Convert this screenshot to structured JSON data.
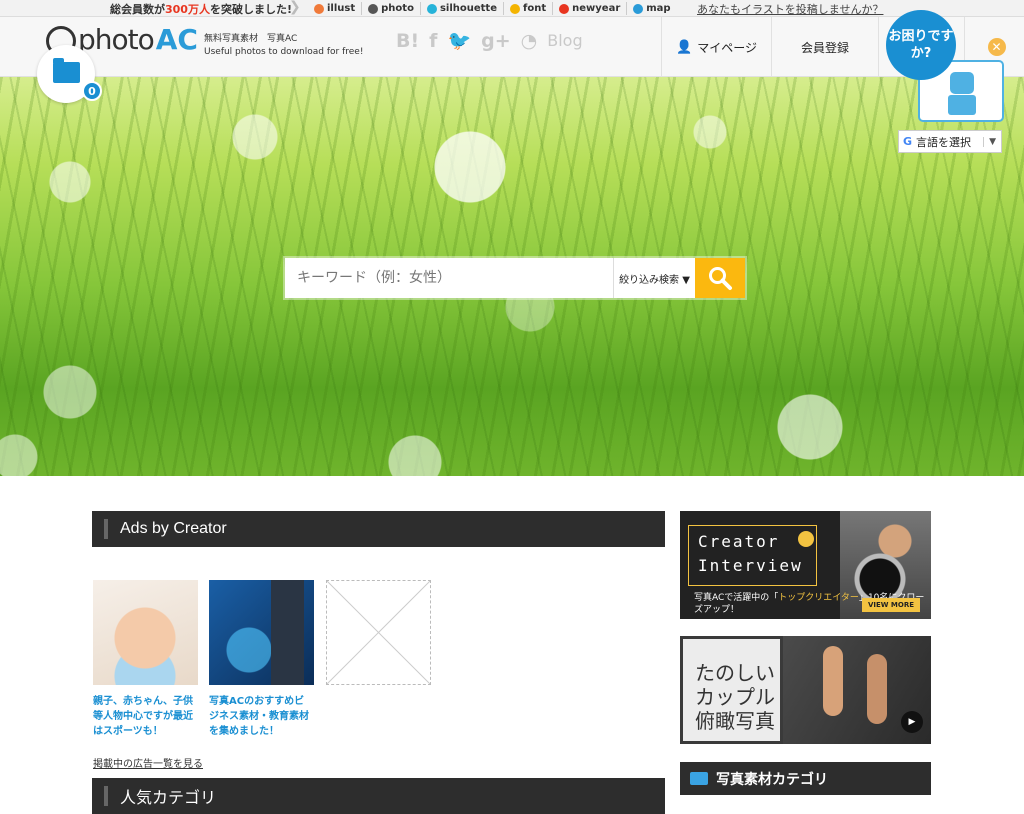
{
  "topbar": {
    "notice_prefix": "総会員数が",
    "notice_num": "300万人",
    "notice_suffix": "を突破しました!",
    "sites": [
      {
        "label": "illust",
        "icon": "illust-icon",
        "color": "#f07a3a"
      },
      {
        "label": "photo",
        "icon": "photo-icon",
        "color": "#555555"
      },
      {
        "label": "silhouette",
        "icon": "silhouette-icon",
        "color": "#26b3d9"
      },
      {
        "label": "font",
        "icon": "font-icon",
        "color": "#f4b400"
      },
      {
        "label": "newyear",
        "icon": "newyear-icon",
        "color": "#e8351f"
      },
      {
        "label": "map",
        "icon": "map-icon",
        "color": "#2a9bd8"
      }
    ],
    "post_link": "あなたもイラストを投稿しませんか？"
  },
  "header": {
    "logo_photo": "photo",
    "logo_ac": "AC",
    "tagline_1": "無料写真素材　写真AC",
    "tagline_2": "Useful photos to download for free!",
    "social": [
      "B!",
      "f",
      "🐦",
      "g+",
      "◔",
      "Blog"
    ],
    "mypage": "マイページ",
    "register": "会員登録",
    "help": "お困りですか?",
    "language": "言語を選択",
    "folder_count": "0"
  },
  "search": {
    "placeholder": "キーワード（例：女性）",
    "filter": "絞り込み検索 ▼"
  },
  "ads": {
    "title": "Ads by Creator",
    "items": [
      {
        "caption": "親子、赤ちゃん、子供等人物中心ですが最近はスポーツも！"
      },
      {
        "caption": "写真ACのおすすめビジネス素材・教育素材を集めました！"
      }
    ],
    "list_link": "掲載中の広告一覧を見る"
  },
  "popular": {
    "title": "人気カテゴリ"
  },
  "sidebar": {
    "banner1": {
      "line1": "Creator",
      "line2": "Interview",
      "sub_prefix": "写真ACで活躍中の「",
      "sub_highlight": "トップクリエイター",
      "sub_suffix": "」10名にクローズアップ！",
      "more": "VIEW MORE"
    },
    "banner2": {
      "text": "たのしい\nカップル\n俯瞰写真"
    },
    "category_title": "写真素材カテゴリ"
  }
}
